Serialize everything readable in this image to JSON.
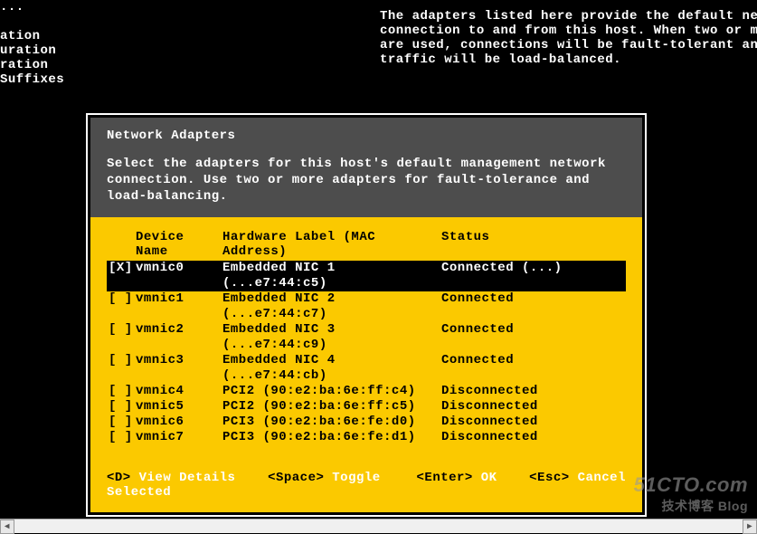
{
  "background": {
    "left_lines": [
      "...",
      "",
      "ation",
      "uration",
      "ration",
      "Suffixes"
    ],
    "right_text": "The adapters listed here provide the default netwo\nconnection to and from this host. When two or more \nare used, connections will be fault-tolerant and ou\ntraffic will be load-balanced."
  },
  "dialog": {
    "title": "Network Adapters",
    "help_line1": "Select the adapters for this host's default management network",
    "help_line2": "connection. Use two or more adapters for fault-tolerance and",
    "help_line3": "load-balancing.",
    "columns": {
      "device": "Device Name",
      "hwlabel": "Hardware Label (MAC Address)",
      "status": "Status"
    },
    "rows": [
      {
        "sel": "[X]",
        "device": "vmnic0",
        "hw": "Embedded NIC 1 (...e7:44:c5)",
        "status": "Connected (...)",
        "highlight": true
      },
      {
        "sel": "[ ]",
        "device": "vmnic1",
        "hw": "Embedded NIC 2 (...e7:44:c7)",
        "status": "Connected"
      },
      {
        "sel": "[ ]",
        "device": "vmnic2",
        "hw": "Embedded NIC 3 (...e7:44:c9)",
        "status": "Connected"
      },
      {
        "sel": "[ ]",
        "device": "vmnic3",
        "hw": "Embedded NIC 4 (...e7:44:cb)",
        "status": "Connected"
      },
      {
        "sel": "[ ]",
        "device": "vmnic4",
        "hw": "PCI2 (90:e2:ba:6e:ff:c4)",
        "status": "Disconnected"
      },
      {
        "sel": "[ ]",
        "device": "vmnic5",
        "hw": "PCI2 (90:e2:ba:6e:ff:c5)",
        "status": "Disconnected"
      },
      {
        "sel": "[ ]",
        "device": "vmnic6",
        "hw": "PCI3 (90:e2:ba:6e:fe:d0)",
        "status": "Disconnected"
      },
      {
        "sel": "[ ]",
        "device": "vmnic7",
        "hw": "PCI3 (90:e2:ba:6e:fe:d1)",
        "status": "Disconnected"
      }
    ],
    "footer": {
      "d_key": "<D>",
      "d_action": "View Details",
      "space_key": "<Space>",
      "space_action": "Toggle Selected",
      "enter_key": "<Enter>",
      "enter_action": "OK",
      "esc_key": "<Esc>",
      "esc_action": "Cancel"
    }
  },
  "watermark": {
    "line1": "51CTO.com",
    "line2": "技术博客    Blog"
  }
}
